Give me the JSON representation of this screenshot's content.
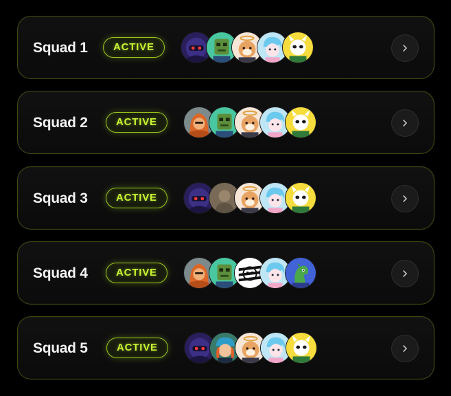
{
  "squads": [
    {
      "name": "Squad 1",
      "status": "ACTIVE",
      "members": [
        "purple-robot-avatar",
        "green-zombie-avatar",
        "shiba-halo-avatar",
        "blue-hair-girl-avatar",
        "horned-panda-avatar"
      ]
    },
    {
      "name": "Squad 2",
      "status": "ACTIVE",
      "members": [
        "orange-hooded-avatar",
        "green-zombie-avatar",
        "shiba-halo-avatar",
        "blue-hair-girl-avatar",
        "horned-panda-avatar"
      ]
    },
    {
      "name": "Squad 3",
      "status": "ACTIVE",
      "members": [
        "purple-robot-avatar",
        "photo-portrait-avatar",
        "shiba-halo-avatar",
        "blue-hair-girl-avatar",
        "horned-panda-avatar"
      ]
    },
    {
      "name": "Squad 4",
      "status": "ACTIVE",
      "members": [
        "orange-hooded-avatar",
        "green-zombie-avatar",
        "zebra-pixel-avatar",
        "blue-hair-girl-avatar",
        "blue-dragon-avatar"
      ]
    },
    {
      "name": "Squad 5",
      "status": "ACTIVE",
      "members": [
        "purple-robot-avatar",
        "cap-girl-avatar",
        "shiba-halo-avatar",
        "blue-hair-girl-avatar",
        "horned-panda-avatar"
      ]
    }
  ],
  "colors": {
    "accent": "#c8f532",
    "card_border": "#3d4a14",
    "background": "#000000"
  },
  "icons": {
    "open": "chevron-right-icon"
  }
}
